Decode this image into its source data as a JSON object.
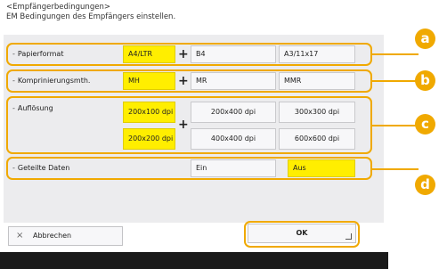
{
  "header": {
    "title": "<Empfängerbedingungen>",
    "subtitle": "EM Bedingungen des Empfängers einstellen."
  },
  "rows": {
    "paper": {
      "label": "Papierformat",
      "options": [
        {
          "label": "A4/LTR",
          "selected": true
        },
        {
          "label": "B4",
          "selected": false
        },
        {
          "label": "A3/11x17",
          "selected": false
        }
      ]
    },
    "compression": {
      "label": "Komprinierungsmth.",
      "options": [
        {
          "label": "MH",
          "selected": true
        },
        {
          "label": "MR",
          "selected": false
        },
        {
          "label": "MMR",
          "selected": false
        }
      ]
    },
    "resolution": {
      "label": "Auflösung",
      "options": [
        {
          "label": "200x100 dpi",
          "selected": true
        },
        {
          "label": "200x200 dpi",
          "selected": true
        },
        {
          "label": "200x400 dpi",
          "selected": false
        },
        {
          "label": "300x300 dpi",
          "selected": false
        },
        {
          "label": "400x400 dpi",
          "selected": false
        },
        {
          "label": "600x600 dpi",
          "selected": false
        }
      ]
    },
    "split": {
      "label": "Geteilte Daten",
      "options": [
        {
          "label": "Ein",
          "selected": false
        },
        {
          "label": "Aus",
          "selected": true
        }
      ]
    }
  },
  "plus_symbol": "+",
  "callouts": [
    "a",
    "b",
    "c",
    "d"
  ],
  "buttons": {
    "cancel": "Abbrechen",
    "cancel_icon": "×",
    "ok": "OK"
  },
  "colors": {
    "highlight": "#f0a900",
    "selected": "#ffee00",
    "panel": "#ececee"
  }
}
